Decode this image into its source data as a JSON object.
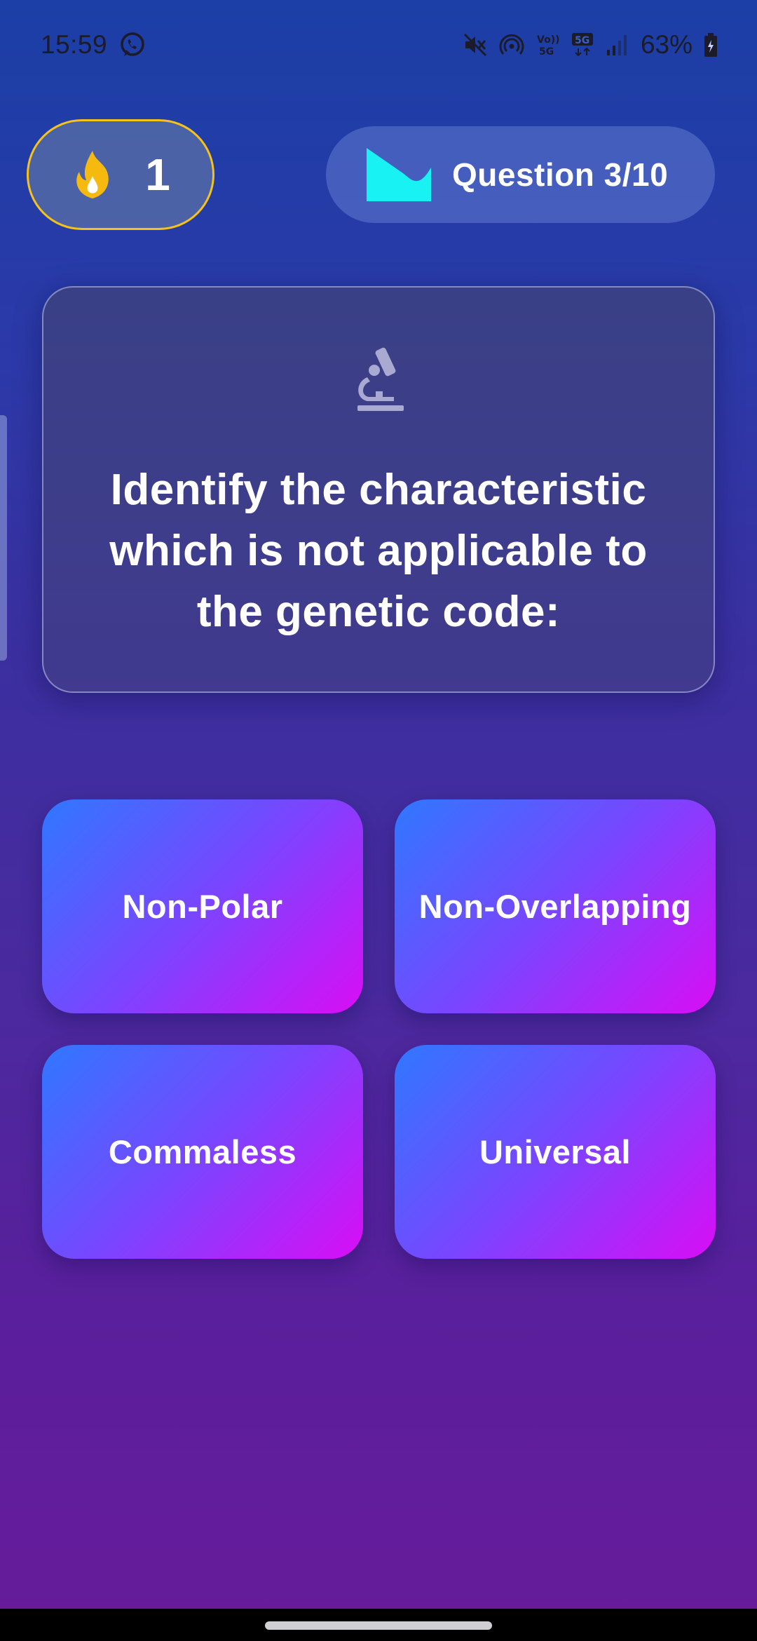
{
  "status_bar": {
    "time": "15:59",
    "battery": "63%",
    "icons": [
      "whatsapp-icon",
      "mute-icon",
      "hotspot-icon",
      "volte-5g-icon",
      "5g-icon",
      "signal-icon",
      "battery-icon"
    ]
  },
  "streak": {
    "icon": "flame-icon",
    "count": "1"
  },
  "progress": {
    "icon": "chart-icon",
    "label": "Question 3/10"
  },
  "question": {
    "icon": "microscope-icon",
    "text": "Identify the characteristic which is not applicable to the genetic code:"
  },
  "answers": [
    {
      "label": "Non-Polar"
    },
    {
      "label": "Non-Overlapping"
    },
    {
      "label": "Commaless"
    },
    {
      "label": "Universal"
    }
  ],
  "colors": {
    "accent_yellow": "#f4c21a",
    "chart_cyan": "#19f2f2",
    "answer_gradient_start": "#2f78ff",
    "answer_gradient_end": "#d90df5"
  }
}
